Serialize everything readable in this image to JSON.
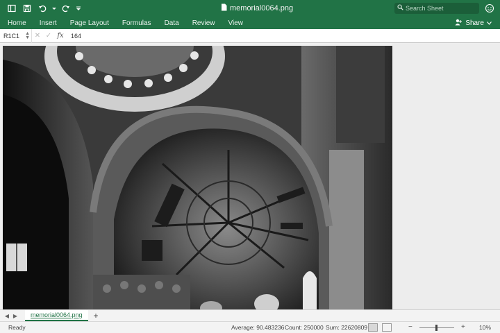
{
  "titlebar": {
    "document_title": "memorial0064.png",
    "search_placeholder": "Search Sheet",
    "icons": [
      "sidebar-icon",
      "save-icon",
      "undo-icon",
      "undo-dropdown-icon",
      "redo-icon",
      "customize-icon",
      "file-icon",
      "search-icon",
      "smiley-icon"
    ]
  },
  "menu": {
    "tabs": [
      "Home",
      "Insert",
      "Page Layout",
      "Formulas",
      "Data",
      "Review",
      "View"
    ],
    "share_label": "Share"
  },
  "formula_bar": {
    "cell_ref": "R1C1",
    "fx_label": "fx",
    "value": "164"
  },
  "sheet": {
    "image_subject": "black-and-white photo of a domed church interior with arches and a chandelier",
    "tab_name": "memorial0064.png"
  },
  "status": {
    "ready": "Ready",
    "average": "Average: 90.483236",
    "count": "Count: 250000",
    "sum": "Sum: 22620809",
    "zoom": "10%"
  },
  "colors": {
    "accent": "#217346",
    "statusbar": "#f3f3f3"
  }
}
